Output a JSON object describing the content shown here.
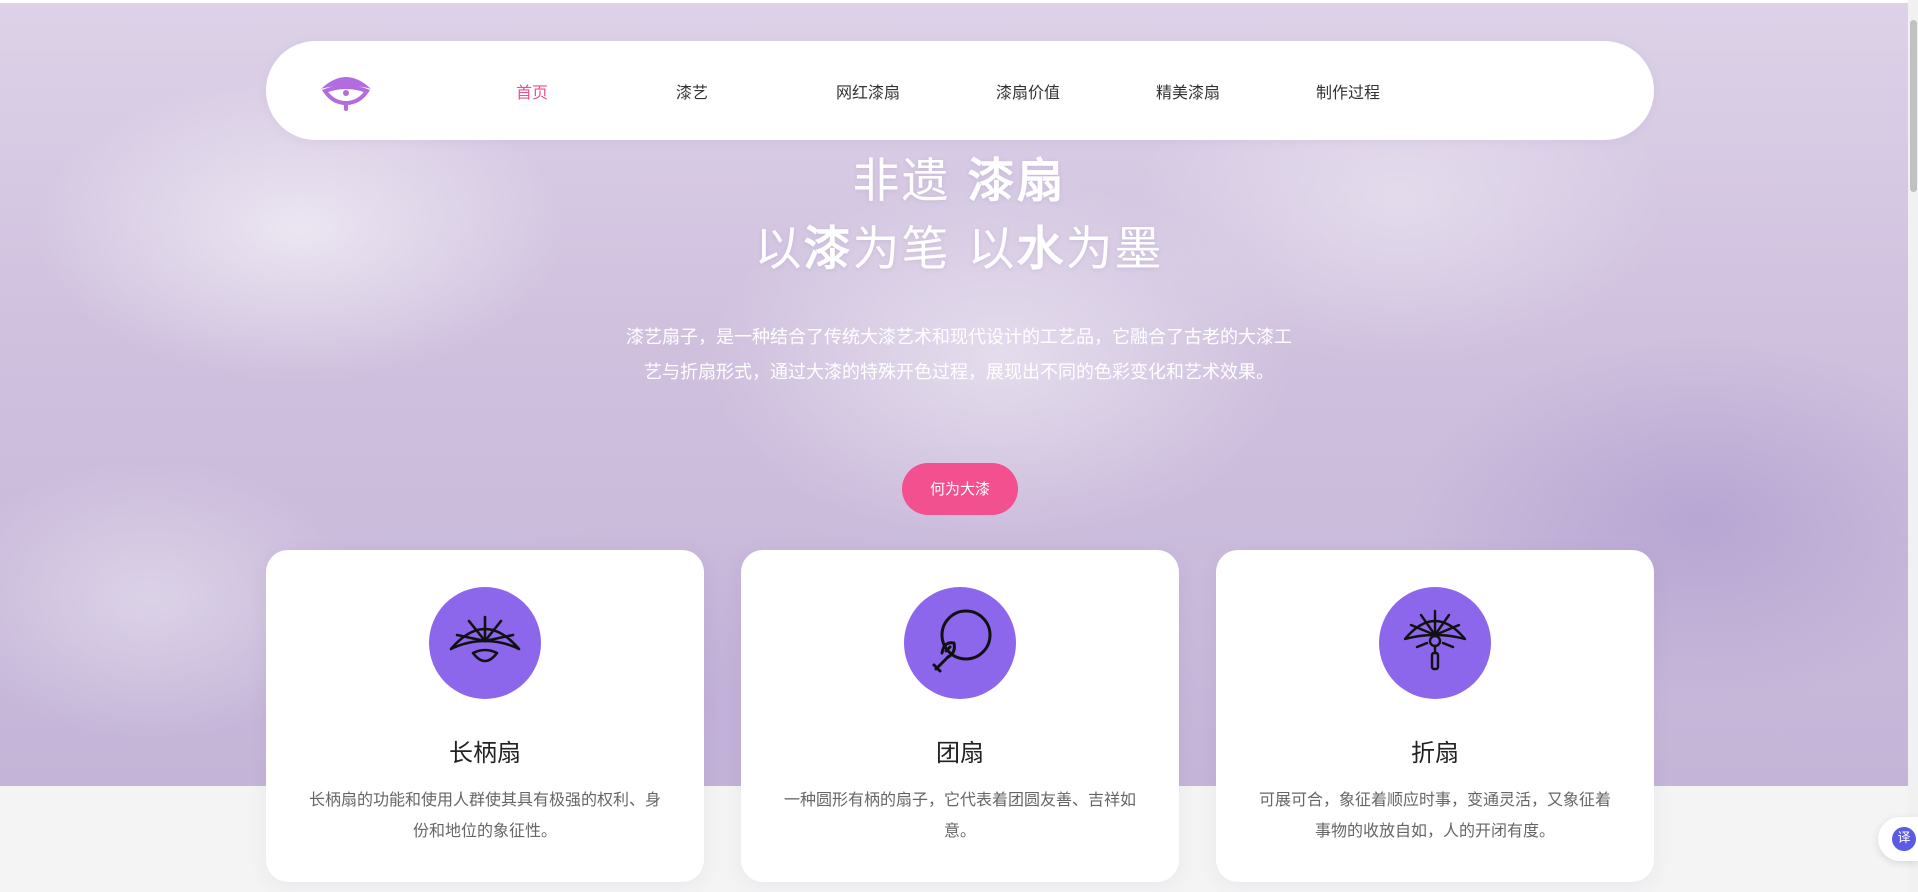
{
  "nav": {
    "items": [
      {
        "label": "首页",
        "active": true
      },
      {
        "label": "漆艺",
        "active": false
      },
      {
        "label": "网红漆扇",
        "active": false
      },
      {
        "label": "漆扇价值",
        "active": false
      },
      {
        "label": "精美漆扇",
        "active": false
      },
      {
        "label": "制作过程",
        "active": false
      }
    ],
    "active_color": "#ee4f93"
  },
  "hero": {
    "title_line1_part1": "非遗 ",
    "title_line1_part2": "漆扇",
    "title_line2_part1": "以",
    "title_line2_part2": "漆",
    "title_line2_part3": "为笔 以",
    "title_line2_part4": "水",
    "title_line2_part5": "为墨",
    "description": "漆艺扇子，是一种结合了传统大漆艺术和现代设计的工艺品，它融合了古老的大漆工艺与折扇形式，通过大漆的特殊开色过程，展现出不同的色彩变化和艺术效果。",
    "cta_label": "何为大漆",
    "cta_color": "#f2508f"
  },
  "cards": [
    {
      "icon": "folding-fan-icon",
      "title": "长柄扇",
      "description": "长柄扇的功能和使用人群使其具有极强的权利、身份和地位的象征性。"
    },
    {
      "icon": "round-fan-icon",
      "title": "团扇",
      "description": "一种圆形有柄的扇子，它代表着团圆友善、吉祥如意。"
    },
    {
      "icon": "tassel-fan-icon",
      "title": "折扇",
      "description": "可展可合，象征着顺应时事，变通灵活，又象征着事物的收放自如，人的开闭有度。"
    }
  ],
  "icon_circle_color": "#8c67ec",
  "translate": {
    "label": "译"
  }
}
